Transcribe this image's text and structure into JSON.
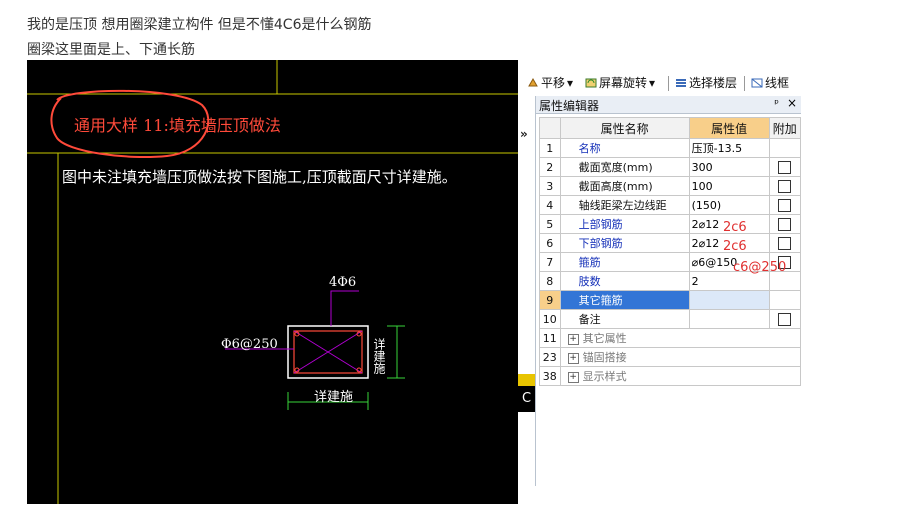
{
  "question": {
    "line1": "我的是压顶  想用圈梁建立构件  但是不懂4C6是什么钢筋",
    "line2": "圈梁这里面是上、下通长筋"
  },
  "cad": {
    "title": "通用大样 11:填充墙压顶做法",
    "note": "图中未注填充墙压顶做法按下图施工,压顶截面尺寸详建施。",
    "top_bar_label": "4Φ6",
    "stirrup_label": "Φ6@250",
    "width_label": "详建施",
    "height_label": "详建施",
    "strip_letter": "C"
  },
  "toolbar": {
    "items": [
      {
        "label": "平移",
        "icon": "pan-icon",
        "has_dropdown": true
      },
      {
        "label": "屏幕旋转",
        "icon": "rotate-icon",
        "has_dropdown": true
      },
      {
        "label": "选择楼层",
        "icon": "floor-icon",
        "has_dropdown": false
      },
      {
        "label": "线框",
        "icon": "wireframe-icon",
        "has_dropdown": false
      }
    ]
  },
  "panel": {
    "title": "属性编辑器",
    "pin": "ᵖ",
    "close": "×",
    "expand_label": "»",
    "headers": {
      "name": "属性名称",
      "value": "属性值",
      "extra": "附加"
    },
    "rows": [
      {
        "no": "1",
        "name": "名称",
        "value": "压顶-13.5",
        "checkbox": false,
        "style": "blue"
      },
      {
        "no": "2",
        "name": "截面宽度(mm)",
        "value": "300",
        "checkbox": true,
        "style": "black"
      },
      {
        "no": "3",
        "name": "截面高度(mm)",
        "value": "100",
        "checkbox": true,
        "style": "black"
      },
      {
        "no": "4",
        "name": "轴线距梁左边线距",
        "value": "(150)",
        "checkbox": true,
        "style": "black"
      },
      {
        "no": "5",
        "name": "上部钢筋",
        "value": "2⌀12",
        "checkbox": true,
        "style": "blue"
      },
      {
        "no": "6",
        "name": "下部钢筋",
        "value": "2⌀12",
        "checkbox": true,
        "style": "blue"
      },
      {
        "no": "7",
        "name": "箍筋",
        "value": "⌀6@150",
        "checkbox": true,
        "style": "blue"
      },
      {
        "no": "8",
        "name": "肢数",
        "value": "2",
        "checkbox": false,
        "style": "blue"
      },
      {
        "no": "9",
        "name": "其它箍筋",
        "value": "",
        "checkbox": false,
        "style": "selected"
      },
      {
        "no": "10",
        "name": "备注",
        "value": "",
        "checkbox": true,
        "style": "black"
      },
      {
        "no": "11",
        "name": "其它属性",
        "value": "",
        "checkbox": false,
        "style": "group"
      },
      {
        "no": "23",
        "name": "锚固搭接",
        "value": "",
        "checkbox": false,
        "style": "group"
      },
      {
        "no": "38",
        "name": "显示样式",
        "value": "",
        "checkbox": false,
        "style": "group"
      }
    ],
    "handwritten": {
      "row5": "2c6",
      "row6": "2c6",
      "row7": "c6@250"
    }
  },
  "colors": {
    "cad_bg": "#000000",
    "cad_red": "#ff4a3a",
    "cad_magenta": "#b000d0",
    "cad_green": "#39d53a",
    "cad_yellow": "#c8c800",
    "header_value": "#f8cf8a",
    "selection": "#3375d6",
    "blue_text": "#1530b8",
    "handwriting": "#e03030"
  }
}
